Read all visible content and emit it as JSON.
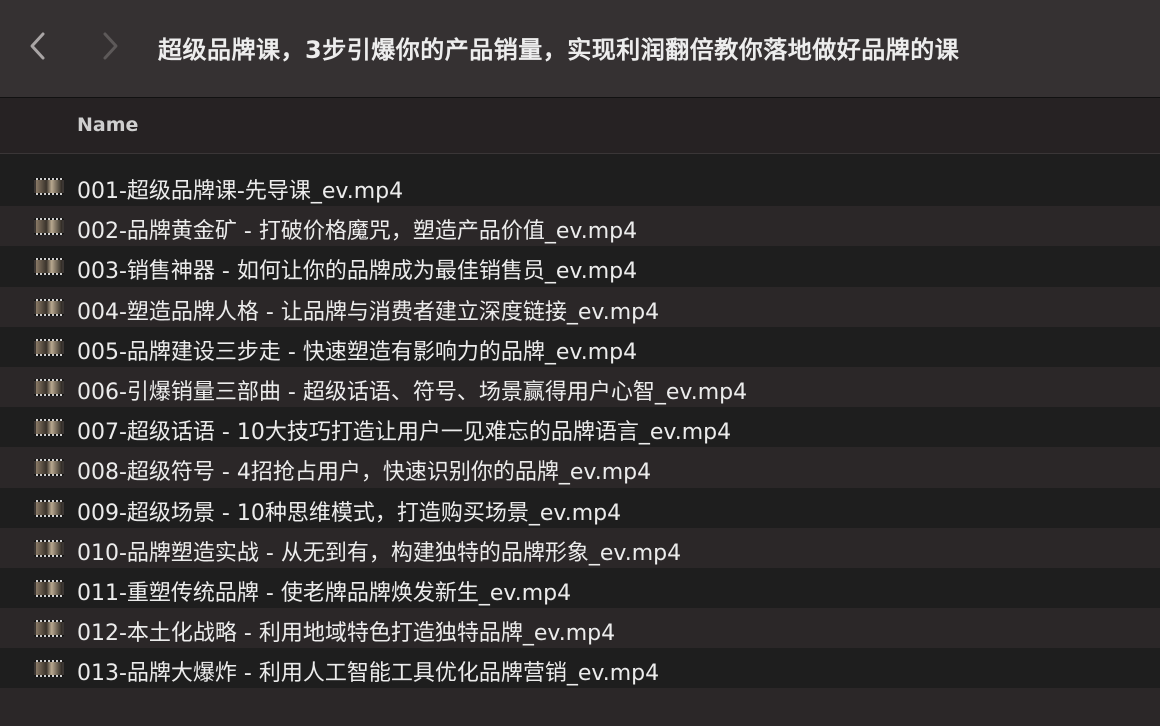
{
  "window": {
    "title": "超级品牌课，3步引爆你的产品销量，实现利润翻倍教你落地做好品牌的课"
  },
  "toolbar": {
    "back_icon": "chevron-left-icon",
    "forward_icon": "chevron-right-icon"
  },
  "columns": {
    "name": "Name"
  },
  "files": [
    {
      "name": "001-超级品牌课-先导课_ev.mp4",
      "icon": "video-file-icon"
    },
    {
      "name": "002-品牌黄金矿 - 打破价格魔咒，塑造产品价值_ev.mp4",
      "icon": "video-file-icon"
    },
    {
      "name": "003-销售神器 - 如何让你的品牌成为最佳销售员_ev.mp4",
      "icon": "video-file-icon"
    },
    {
      "name": "004-塑造品牌人格 - 让品牌与消费者建立深度链接_ev.mp4",
      "icon": "video-file-icon"
    },
    {
      "name": "005-品牌建设三步走 - 快速塑造有影响力的品牌_ev.mp4",
      "icon": "video-file-icon"
    },
    {
      "name": "006-引爆销量三部曲 - 超级话语、符号、场景赢得用户心智_ev.mp4",
      "icon": "video-file-icon"
    },
    {
      "name": "007-超级话语 - 10大技巧打造让用户一见难忘的品牌语言_ev.mp4",
      "icon": "video-file-icon"
    },
    {
      "name": "008-超级符号 - 4招抢占用户，快速识别你的品牌_ev.mp4",
      "icon": "video-file-icon"
    },
    {
      "name": "009-超级场景 - 10种思维模式，打造购买场景_ev.mp4",
      "icon": "video-file-icon"
    },
    {
      "name": "010-品牌塑造实战 - 从无到有，构建独特的品牌形象_ev.mp4",
      "icon": "video-file-icon"
    },
    {
      "name": "011-重塑传统品牌 - 使老牌品牌焕发新生_ev.mp4",
      "icon": "video-file-icon"
    },
    {
      "name": "012-本土化战略 - 利用地域特色打造独特品牌_ev.mp4",
      "icon": "video-file-icon"
    },
    {
      "name": "013-品牌大爆炸 - 利用人工智能工具优化品牌营销_ev.mp4",
      "icon": "video-file-icon"
    }
  ]
}
